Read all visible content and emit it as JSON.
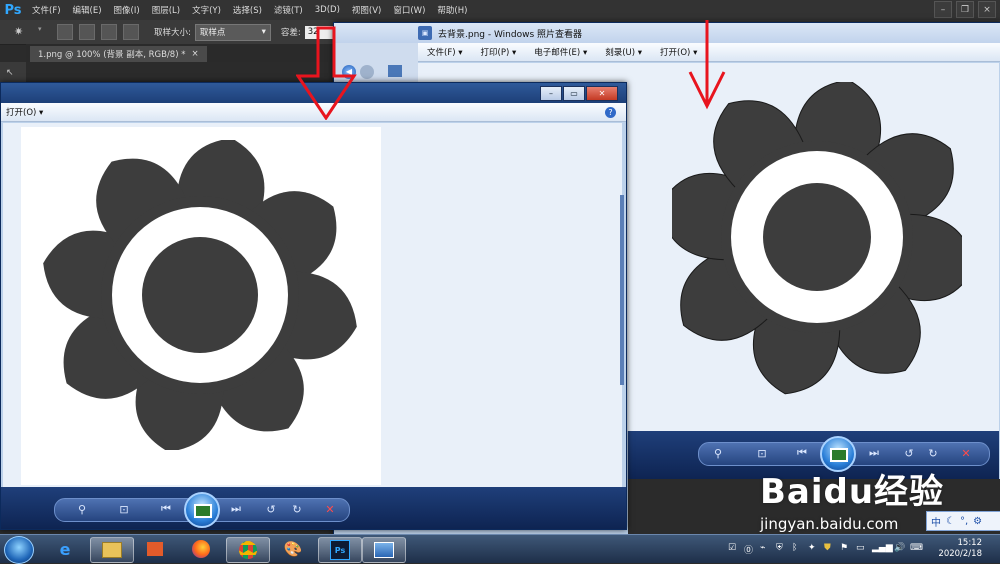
{
  "photoshop": {
    "logo": "Ps",
    "menu": [
      "文件(F)",
      "编辑(E)",
      "图像(I)",
      "图层(L)",
      "文字(Y)",
      "选择(S)",
      "滤镜(T)",
      "3D(D)",
      "视图(V)",
      "窗口(W)",
      "帮助(H)"
    ],
    "options": {
      "sample_size_label": "取样大小:",
      "sample_size_value": "取样点",
      "tolerance_label": "容差:",
      "tolerance_value": "32"
    },
    "doc_tab": "1.png @ 100% (背景 副本, RGB/8) *",
    "doc_tab_close": "×"
  },
  "viewer_front": {
    "menu_open": "打开(O)",
    "help": "?"
  },
  "viewer_back": {
    "title": "去背景.png - Windows 照片查看器",
    "menu": [
      "文件(F)",
      "打印(P)",
      "电子邮件(E)",
      "刻录(U)",
      "打开(O)"
    ]
  },
  "taskbar": {
    "ime": "中",
    "time": "15:12",
    "date": "2020/2/18"
  },
  "watermark": {
    "brand": "Baidu经验",
    "url": "jingyan.baidu.com"
  },
  "colors": {
    "flower": "#3d3d3d",
    "arrow": "#e8141e",
    "viewer_canvas": "#e9f0f9"
  }
}
